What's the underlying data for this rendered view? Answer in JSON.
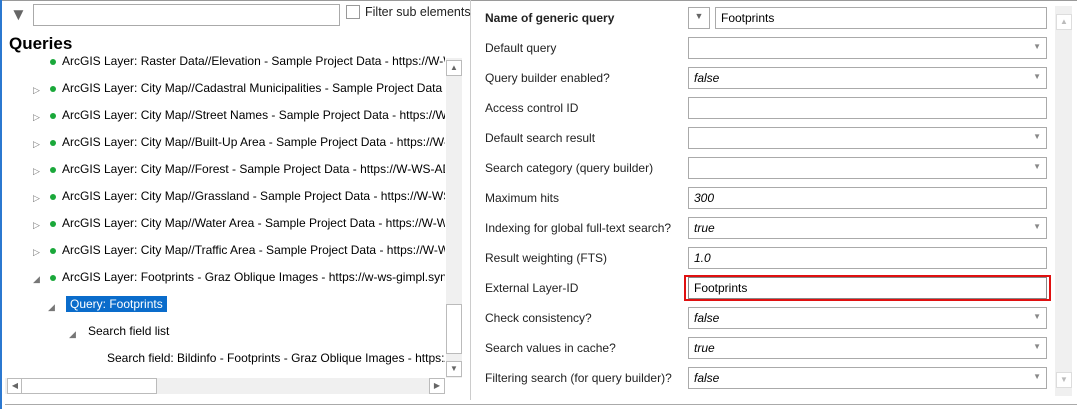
{
  "filter": {
    "value": "",
    "checkbox_label": "Filter sub elements"
  },
  "tree": {
    "title": "Queries",
    "items": [
      "ArcGIS Layer: Raster Data//Elevation - Sample Project Data - https://W-WS-A",
      "ArcGIS Layer: City Map//Cadastral Municipalities - Sample Project Data - http",
      "ArcGIS Layer: City Map//Street Names - Sample Project Data - https://W-WS-",
      "ArcGIS Layer: City Map//Built-Up Area - Sample Project Data - https://W-WS-",
      "ArcGIS Layer: City Map//Forest - Sample Project Data - https://W-WS-ADELPC",
      "ArcGIS Layer: City Map//Grassland - Sample Project Data - https://W-WS-AD",
      "ArcGIS Layer: City Map//Water Area - Sample Project Data - https://W-WS-AD",
      "ArcGIS Layer: City Map//Traffic Area - Sample Project Data - https://W-WS-AD",
      "ArcGIS Layer: Footprints - Graz Oblique Images - https://w-ws-gimpl.synerg"
    ],
    "query": "Query: Footprints",
    "search_list": "Search field list",
    "search_field": "Search field: Bildinfo - Footprints - Graz Oblique Images - https://w"
  },
  "properties": [
    {
      "label": "Name of generic query",
      "value": "Footprints"
    },
    {
      "label": "Default query",
      "value": ""
    },
    {
      "label": "Query builder enabled?",
      "value": "false"
    },
    {
      "label": "Access control ID",
      "value": ""
    },
    {
      "label": "Default search result",
      "value": ""
    },
    {
      "label": "Search category (query builder)",
      "value": ""
    },
    {
      "label": "Maximum hits",
      "value": "300"
    },
    {
      "label": "Indexing for global full-text search?",
      "value": "true"
    },
    {
      "label": "Result weighting (FTS)",
      "value": "1.0"
    },
    {
      "label": "External Layer-ID",
      "value": "Footprints"
    },
    {
      "label": "Check consistency?",
      "value": "false"
    },
    {
      "label": "Search values in cache?",
      "value": "true"
    },
    {
      "label": "Filtering search (for query builder)?",
      "value": "false"
    }
  ]
}
